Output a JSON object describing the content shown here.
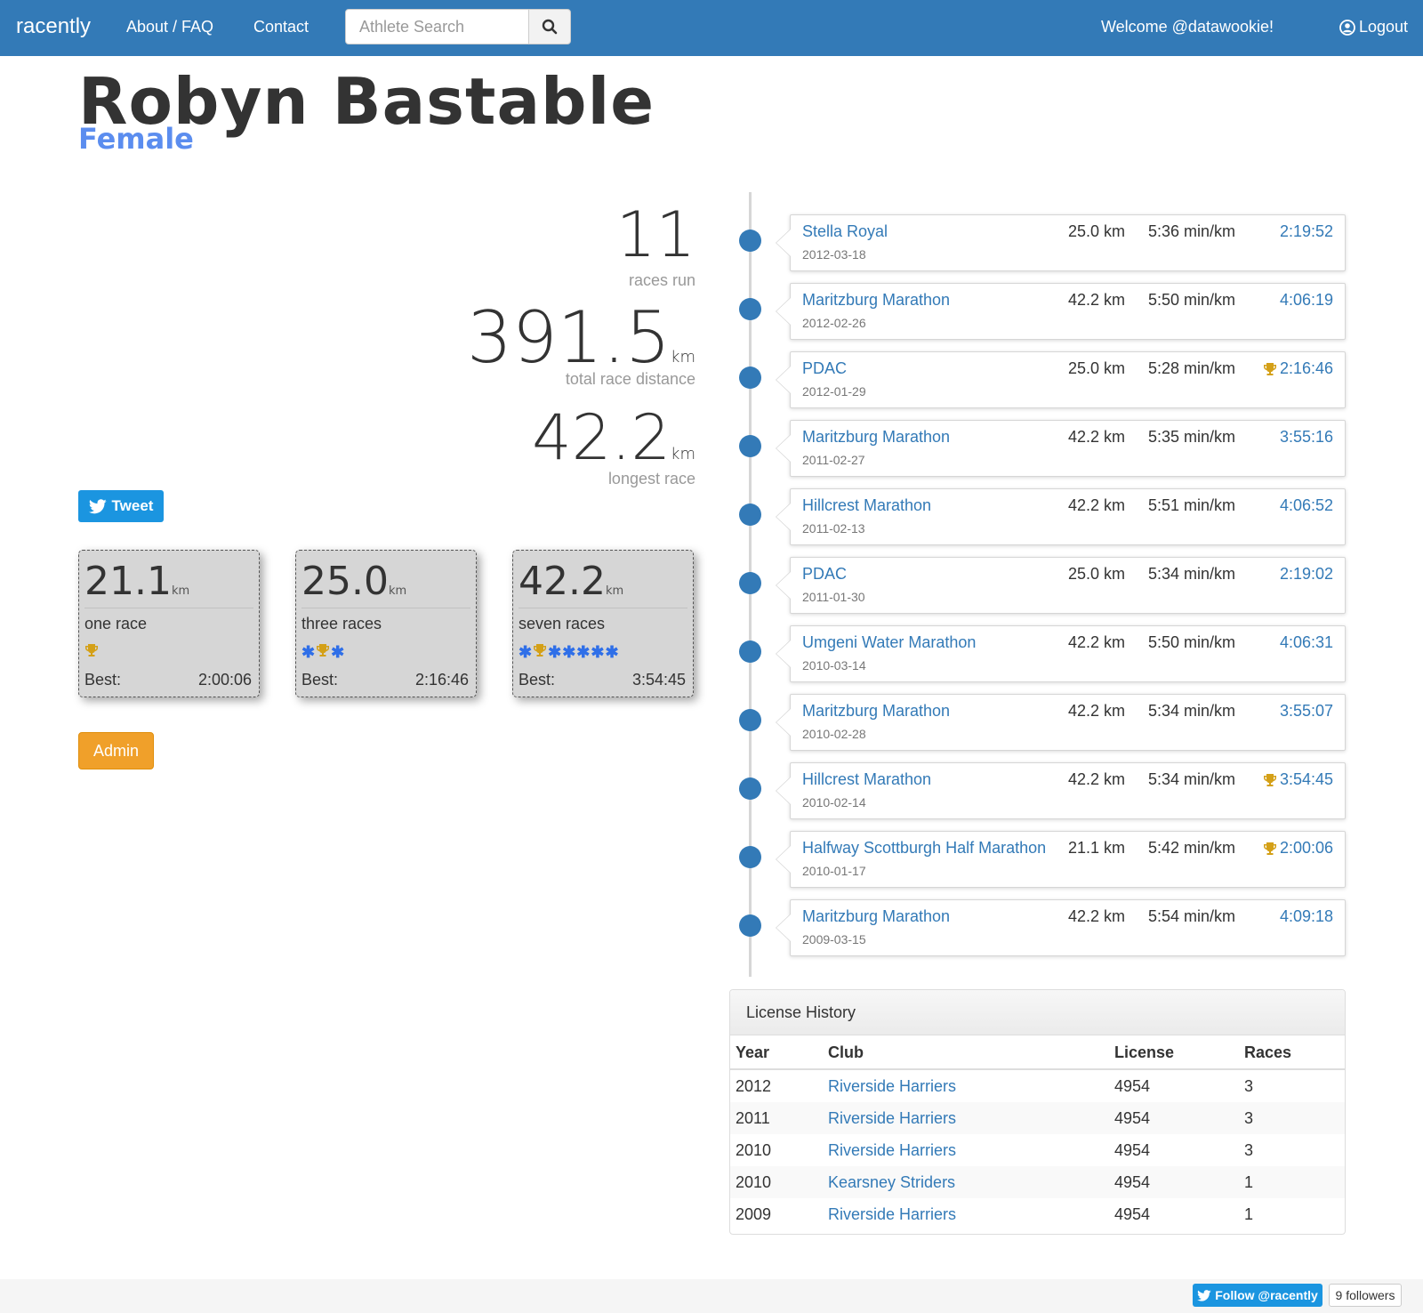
{
  "nav": {
    "brand": "racently",
    "about": "About / FAQ",
    "contact": "Contact",
    "search_placeholder": "Athlete Search",
    "welcome": "Welcome @datawookie!",
    "logout": "Logout"
  },
  "athlete": {
    "name": "Robyn Bastable",
    "gender": "Female"
  },
  "stats": {
    "races": "11",
    "races_caption": "races run",
    "total_distance": "391.5",
    "total_unit": "km",
    "total_caption": "total race distance",
    "longest": "42.2",
    "longest_unit": "km",
    "longest_caption": "longest race"
  },
  "tweet_label": "Tweet",
  "distances": [
    {
      "distance": "21.1",
      "unit": "km",
      "count": "one race",
      "best_label": "Best:",
      "best": "2:00:06",
      "badges": [
        "trophy"
      ]
    },
    {
      "distance": "25.0",
      "unit": "km",
      "count": "three races",
      "best_label": "Best:",
      "best": "2:16:46",
      "badges": [
        "star",
        "trophy",
        "star"
      ]
    },
    {
      "distance": "42.2",
      "unit": "km",
      "count": "seven races",
      "best_label": "Best:",
      "best": "3:54:45",
      "badges": [
        "star",
        "trophy",
        "star",
        "star",
        "star",
        "star",
        "star"
      ]
    }
  ],
  "admin_label": "Admin",
  "races": [
    {
      "name": "Stella Royal",
      "date": "2012-03-18",
      "distance": "25.0 km",
      "pace": "5:36 min/km",
      "time": "2:19:52",
      "pb": false
    },
    {
      "name": "Maritzburg Marathon",
      "date": "2012-02-26",
      "distance": "42.2 km",
      "pace": "5:50 min/km",
      "time": "4:06:19",
      "pb": false
    },
    {
      "name": "PDAC",
      "date": "2012-01-29",
      "distance": "25.0 km",
      "pace": "5:28 min/km",
      "time": "2:16:46",
      "pb": true
    },
    {
      "name": "Maritzburg Marathon",
      "date": "2011-02-27",
      "distance": "42.2 km",
      "pace": "5:35 min/km",
      "time": "3:55:16",
      "pb": false
    },
    {
      "name": "Hillcrest Marathon",
      "date": "2011-02-13",
      "distance": "42.2 km",
      "pace": "5:51 min/km",
      "time": "4:06:52",
      "pb": false
    },
    {
      "name": "PDAC",
      "date": "2011-01-30",
      "distance": "25.0 km",
      "pace": "5:34 min/km",
      "time": "2:19:02",
      "pb": false
    },
    {
      "name": "Umgeni Water Marathon",
      "date": "2010-03-14",
      "distance": "42.2 km",
      "pace": "5:50 min/km",
      "time": "4:06:31",
      "pb": false
    },
    {
      "name": "Maritzburg Marathon",
      "date": "2010-02-28",
      "distance": "42.2 km",
      "pace": "5:34 min/km",
      "time": "3:55:07",
      "pb": false
    },
    {
      "name": "Hillcrest Marathon",
      "date": "2010-02-14",
      "distance": "42.2 km",
      "pace": "5:34 min/km",
      "time": "3:54:45",
      "pb": true
    },
    {
      "name": "Halfway Scottburgh Half Marathon",
      "date": "2010-01-17",
      "distance": "21.1 km",
      "pace": "5:42 min/km",
      "time": "2:00:06",
      "pb": true
    },
    {
      "name": "Maritzburg Marathon",
      "date": "2009-03-15",
      "distance": "42.2 km",
      "pace": "5:54 min/km",
      "time": "4:09:18",
      "pb": false
    }
  ],
  "license": {
    "title": "License History",
    "headers": {
      "year": "Year",
      "club": "Club",
      "license": "License",
      "races": "Races"
    },
    "rows": [
      {
        "year": "2012",
        "club": "Riverside Harriers",
        "license": "4954",
        "races": "3"
      },
      {
        "year": "2011",
        "club": "Riverside Harriers",
        "license": "4954",
        "races": "3"
      },
      {
        "year": "2010",
        "club": "Riverside Harriers",
        "license": "4954",
        "races": "3"
      },
      {
        "year": "2010",
        "club": "Kearsney Striders",
        "license": "4954",
        "races": "1"
      },
      {
        "year": "2009",
        "club": "Riverside Harriers",
        "license": "4954",
        "races": "1"
      }
    ]
  },
  "footer": {
    "follow": "Follow @racently",
    "followers": "9 followers"
  },
  "colors": {
    "primary": "#337ab7",
    "gender": "#5b8def",
    "trophy": "#d4a017",
    "star": "#2f6fe8",
    "admin": "#f0a02a",
    "twitter": "#1b95e0"
  }
}
